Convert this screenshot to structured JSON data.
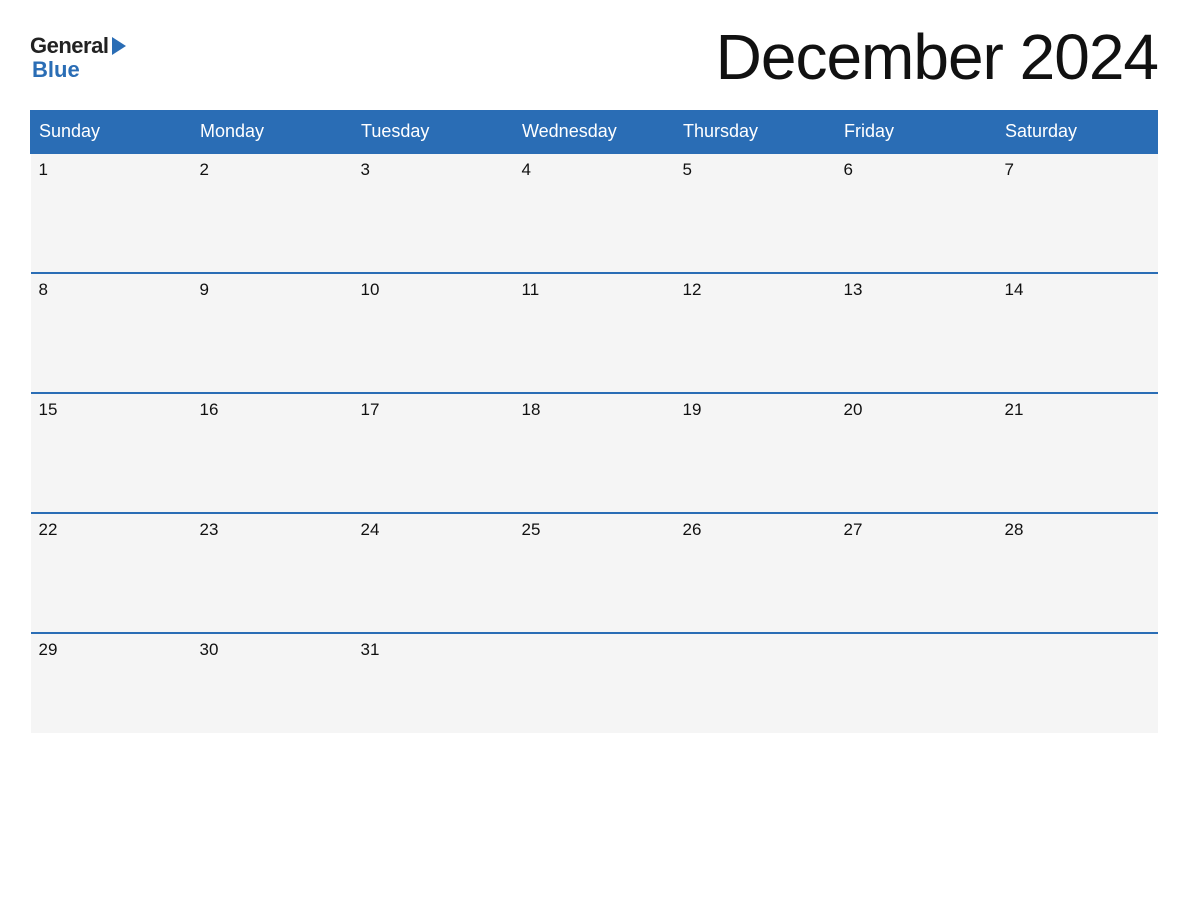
{
  "logo": {
    "general_text": "General",
    "blue_text": "Blue"
  },
  "title": "December 2024",
  "days_of_week": [
    "Sunday",
    "Monday",
    "Tuesday",
    "Wednesday",
    "Thursday",
    "Friday",
    "Saturday"
  ],
  "weeks": [
    [
      {
        "day": "1",
        "empty": false
      },
      {
        "day": "2",
        "empty": false
      },
      {
        "day": "3",
        "empty": false
      },
      {
        "day": "4",
        "empty": false
      },
      {
        "day": "5",
        "empty": false
      },
      {
        "day": "6",
        "empty": false
      },
      {
        "day": "7",
        "empty": false
      }
    ],
    [
      {
        "day": "8",
        "empty": false
      },
      {
        "day": "9",
        "empty": false
      },
      {
        "day": "10",
        "empty": false
      },
      {
        "day": "11",
        "empty": false
      },
      {
        "day": "12",
        "empty": false
      },
      {
        "day": "13",
        "empty": false
      },
      {
        "day": "14",
        "empty": false
      }
    ],
    [
      {
        "day": "15",
        "empty": false
      },
      {
        "day": "16",
        "empty": false
      },
      {
        "day": "17",
        "empty": false
      },
      {
        "day": "18",
        "empty": false
      },
      {
        "day": "19",
        "empty": false
      },
      {
        "day": "20",
        "empty": false
      },
      {
        "day": "21",
        "empty": false
      }
    ],
    [
      {
        "day": "22",
        "empty": false
      },
      {
        "day": "23",
        "empty": false
      },
      {
        "day": "24",
        "empty": false
      },
      {
        "day": "25",
        "empty": false
      },
      {
        "day": "26",
        "empty": false
      },
      {
        "day": "27",
        "empty": false
      },
      {
        "day": "28",
        "empty": false
      }
    ],
    [
      {
        "day": "29",
        "empty": false
      },
      {
        "day": "30",
        "empty": false
      },
      {
        "day": "31",
        "empty": false
      },
      {
        "day": "",
        "empty": true
      },
      {
        "day": "",
        "empty": true
      },
      {
        "day": "",
        "empty": true
      },
      {
        "day": "",
        "empty": true
      }
    ]
  ],
  "colors": {
    "header_bg": "#2a6db5",
    "header_text": "#ffffff",
    "cell_bg": "#f5f5f5",
    "empty_bg": "#ffffff",
    "border": "#2a6db5",
    "text": "#111111"
  }
}
